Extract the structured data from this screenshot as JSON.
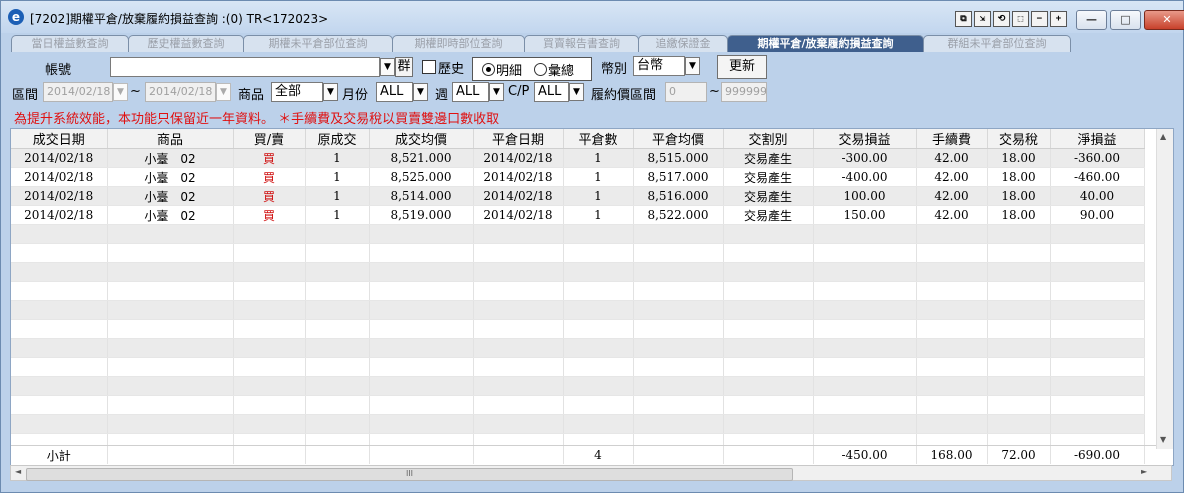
{
  "window": {
    "title": "[7202]期權平倉/放棄履約損益查詢 :(0) TR<172023>",
    "app_icon": "e",
    "tool_buttons": [
      "⧉",
      "⇲",
      "⟲",
      "⬚",
      "−",
      "+"
    ],
    "controls": {
      "minimize": "—",
      "maximize": "□",
      "close": "✕"
    }
  },
  "tabs": [
    {
      "label": "當日權益數查詢",
      "active": false
    },
    {
      "label": "歷史權益數查詢",
      "active": false
    },
    {
      "label": "期權未平倉部位查詢",
      "active": false
    },
    {
      "label": "期權即時部位查詢",
      "active": false
    },
    {
      "label": "買賣報告書查詢",
      "active": false
    },
    {
      "label": "追繳保證金",
      "active": false
    },
    {
      "label": "期權平倉/放棄履約損益查詢",
      "active": true
    },
    {
      "label": "群組未平倉部位查詢",
      "active": false
    }
  ],
  "form": {
    "account_label": "帳號",
    "account_value": "",
    "group_button": "群",
    "history_label": "歷史",
    "history_checked": false,
    "detail_label": "明細",
    "summary_label": "彙總",
    "view_mode": "detail",
    "currency_label": "幣別",
    "currency_value": "台幣",
    "refresh_button": "更新",
    "range_label": "區間",
    "date_from": "2014/02/18",
    "tilde": "~",
    "date_to": "2014/02/18",
    "product_label": "商品",
    "product_value": "全部",
    "month_label": "月份",
    "month_value": "ALL",
    "week_label": "週",
    "week_value": "ALL",
    "cp_label": "C/P",
    "cp_value": "ALL",
    "strike_label": "履約價區間",
    "strike_from": "0",
    "strike_to": "999999",
    "dropdown_arrow": "▼"
  },
  "notice": "為提升系統效能，本功能只保留近一年資料。  ＊手續費及交易稅以買賣雙邊口數收取",
  "table": {
    "columns": [
      "成交日期",
      "商品",
      "買/賣",
      "原成交",
      "成交均價",
      "平倉日期",
      "平倉數",
      "平倉均價",
      "交割別",
      "交易損益",
      "手續費",
      "交易稅",
      "淨損益"
    ],
    "rows": [
      [
        "2014/02/18",
        "小臺　02",
        "買",
        "1",
        "8,521.000",
        "2014/02/18",
        "1",
        "8,515.000",
        "交易產生",
        "-300.00",
        "42.00",
        "18.00",
        "-360.00"
      ],
      [
        "2014/02/18",
        "小臺　02",
        "買",
        "1",
        "8,525.000",
        "2014/02/18",
        "1",
        "8,517.000",
        "交易產生",
        "-400.00",
        "42.00",
        "18.00",
        "-460.00"
      ],
      [
        "2014/02/18",
        "小臺　02",
        "買",
        "1",
        "8,514.000",
        "2014/02/18",
        "1",
        "8,516.000",
        "交易產生",
        "100.00",
        "42.00",
        "18.00",
        "40.00"
      ],
      [
        "2014/02/18",
        "小臺　02",
        "買",
        "1",
        "8,519.000",
        "2014/02/18",
        "1",
        "8,522.000",
        "交易產生",
        "150.00",
        "42.00",
        "18.00",
        "90.00"
      ]
    ],
    "subtotal": {
      "label": "小計",
      "close_qty": "4",
      "trade_pl": "-450.00",
      "fee": "168.00",
      "tax": "72.00",
      "net_pl": "-690.00"
    }
  },
  "scroll": {
    "up": "▲",
    "down": "▼",
    "left": "◄",
    "right": "►",
    "grip": "III"
  }
}
